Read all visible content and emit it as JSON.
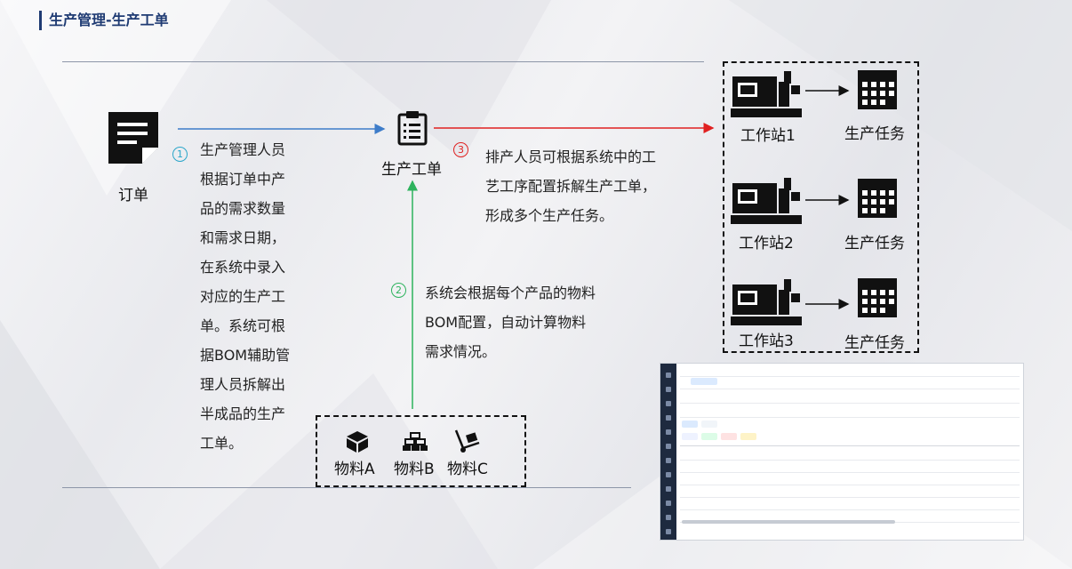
{
  "title": "生产管理-生产工单",
  "nodes": {
    "order": "订单",
    "workorder": "生产工单",
    "stations": [
      "工作站1",
      "工作站2",
      "工作站3"
    ],
    "tasks": [
      "生产任务",
      "生产任务",
      "生产任务"
    ],
    "materials": [
      "物料A",
      "物料B",
      "物料C"
    ]
  },
  "steps": {
    "s1_num": "1",
    "s1_text": [
      "生产管理人员",
      "根据订单中产",
      "品的需求数量",
      "和需求日期，",
      "在系统中录入",
      "对应的生产工",
      "单。系统可根",
      "据BOM辅助管",
      "理人员拆解出",
      "半成品的生产",
      "工单。"
    ],
    "s2_num": "2",
    "s2_text": [
      "系统会根据每个产品的物料",
      "BOM配置，自动计算物料",
      "需求情况。"
    ],
    "s3_num": "3",
    "s3_text": [
      "排产人员可根据系统中的工",
      "艺工序配置拆解生产工单，",
      "形成多个生产任务。"
    ]
  },
  "colors": {
    "blue_arrow": "#3d7cc9",
    "red_arrow": "#e02020",
    "green_arrow": "#2db35d",
    "step1": "#2aa6c9",
    "step2": "#2db35d",
    "step3": "#e02020",
    "title": "#1f3b73"
  }
}
